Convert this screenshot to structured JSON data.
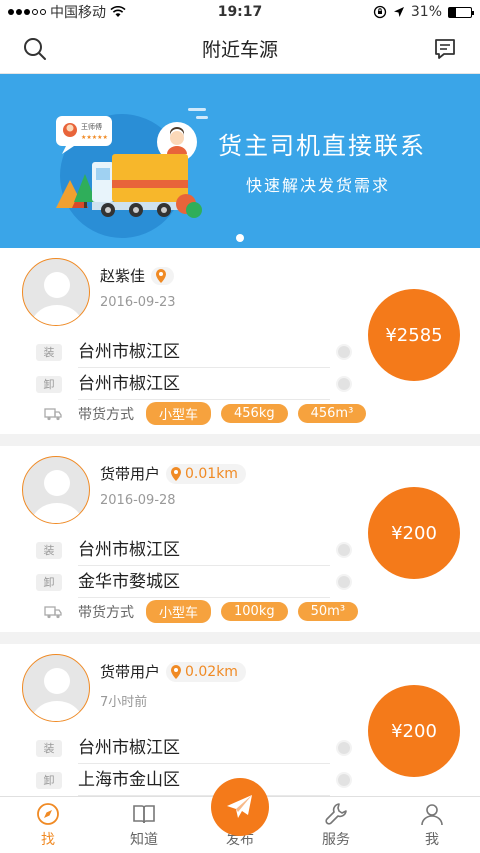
{
  "status_bar": {
    "carrier": "中国移动",
    "time": "19:17",
    "battery": "31%",
    "battery_level": 0.31
  },
  "header": {
    "title": "附近车源"
  },
  "banner": {
    "headline": "货主司机直接联系",
    "subline": "快速解决发货需求",
    "driver_tag": "王师傅",
    "stars": "★★★★★"
  },
  "listings": [
    {
      "name": "赵紫佳",
      "distance": "",
      "date": "2016-09-23",
      "load_tag": "装",
      "load": "台州市椒江区",
      "unload_tag": "卸",
      "unload": "台州市椒江区",
      "cargo_label": "带货方式",
      "vehicle": "小型车",
      "weight": "456kg",
      "volume": "456m³",
      "price": "¥2585"
    },
    {
      "name": "货带用户",
      "distance": "0.01km",
      "date": "2016-09-28",
      "load_tag": "装",
      "load": "台州市椒江区",
      "unload_tag": "卸",
      "unload": "金华市婺城区",
      "cargo_label": "带货方式",
      "vehicle": "小型车",
      "weight": "100kg",
      "volume": "50m³",
      "price": "¥200"
    },
    {
      "name": "货带用户",
      "distance": "0.02km",
      "date": "7小时前",
      "load_tag": "装",
      "load": "台州市椒江区",
      "unload_tag": "卸",
      "unload": "上海市金山区",
      "cargo_label": "",
      "vehicle": "",
      "weight": "",
      "volume": "",
      "price": "¥200"
    }
  ],
  "tabs": [
    {
      "label": "找",
      "icon": "compass-icon",
      "active": true
    },
    {
      "label": "知道",
      "icon": "book-icon",
      "active": false
    },
    {
      "label": "发布",
      "icon": "paper-plane-icon",
      "active": false
    },
    {
      "label": "服务",
      "icon": "wrench-icon",
      "active": false
    },
    {
      "label": "我",
      "icon": "user-icon",
      "active": false
    }
  ],
  "colors": {
    "accent": "#f47a1a",
    "chip": "#f6a23e",
    "banner": "#3aa5e8"
  }
}
